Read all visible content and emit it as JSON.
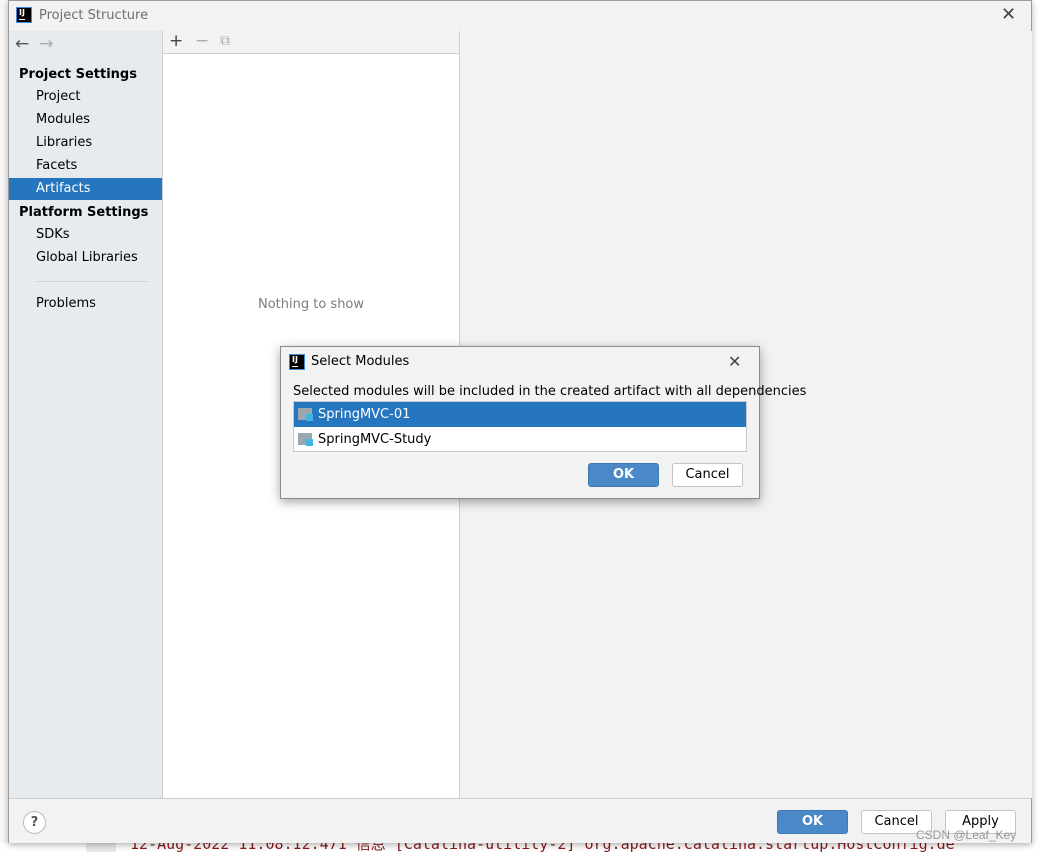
{
  "window": {
    "title": "Project Structure"
  },
  "sidebar": {
    "sections": [
      {
        "title": "Project Settings",
        "items": [
          "Project",
          "Modules",
          "Libraries",
          "Facets",
          "Artifacts"
        ]
      },
      {
        "title": "Platform Settings",
        "items": [
          "SDKs",
          "Global Libraries"
        ]
      }
    ],
    "problems": "Problems",
    "selected": "Artifacts"
  },
  "middle": {
    "empty_text": "Nothing to show"
  },
  "footer": {
    "ok": "OK",
    "cancel": "Cancel",
    "apply": "Apply",
    "help": "?"
  },
  "modal": {
    "title": "Select Modules",
    "label": "Selected modules will be included in the created artifact with all dependencies",
    "modules": [
      "SpringMVC-01",
      "SpringMVC-Study"
    ],
    "selected": "SpringMVC-01",
    "ok": "OK",
    "cancel": "Cancel"
  },
  "background": {
    "log_line": "12-Aug-2022 11:08:12.471 信息 [Catalina-utility-2] org.apache.catalina.startup.HostConfig.de"
  },
  "watermark": "CSDN @Leaf_Key",
  "colors": {
    "selection": "#2675bf",
    "primary_button": "#4a88c7",
    "sidebar_bg": "#e6ebf0"
  }
}
